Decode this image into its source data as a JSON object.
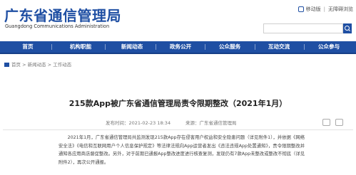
{
  "header": {
    "title": "广东省通信管理局",
    "subtitle": "Guangdong Communications Administration",
    "links": [
      "移动版",
      "无障碍浏览"
    ]
  },
  "nav": {
    "items": [
      "首页",
      "机构职能",
      "新闻动态",
      "政务公开",
      "公众服务",
      "互动交流",
      "公众参与"
    ]
  },
  "breadcrumb": {
    "items": [
      "首页",
      "新闻动态",
      "工作动态"
    ],
    "separator": " > "
  },
  "article": {
    "title": "215款App被广东省通信管理局责令限期整改（2021年1月）",
    "publish_time": "发布时间：2021-02-23 18:34",
    "source": "来源：广东省通信管理局",
    "body": "2021年1月，广东省通信管理局共监测发现215款App存在侵害用户权益和安全隐患问题（详见附件1），并依据《网络安全法》《电信和互联网用户个人信息保护规定》等法律法规向App运营者发出《违法违规App处置通知》，责令限期整改并通知各应用商店督促整改。另外，对于前期已通报App整改进度进行核查复测，发现仍有7款App未整改或整改不彻底（详见附件2），再次公开通报。"
  },
  "colors": {
    "brand": "#1f4fa3"
  }
}
